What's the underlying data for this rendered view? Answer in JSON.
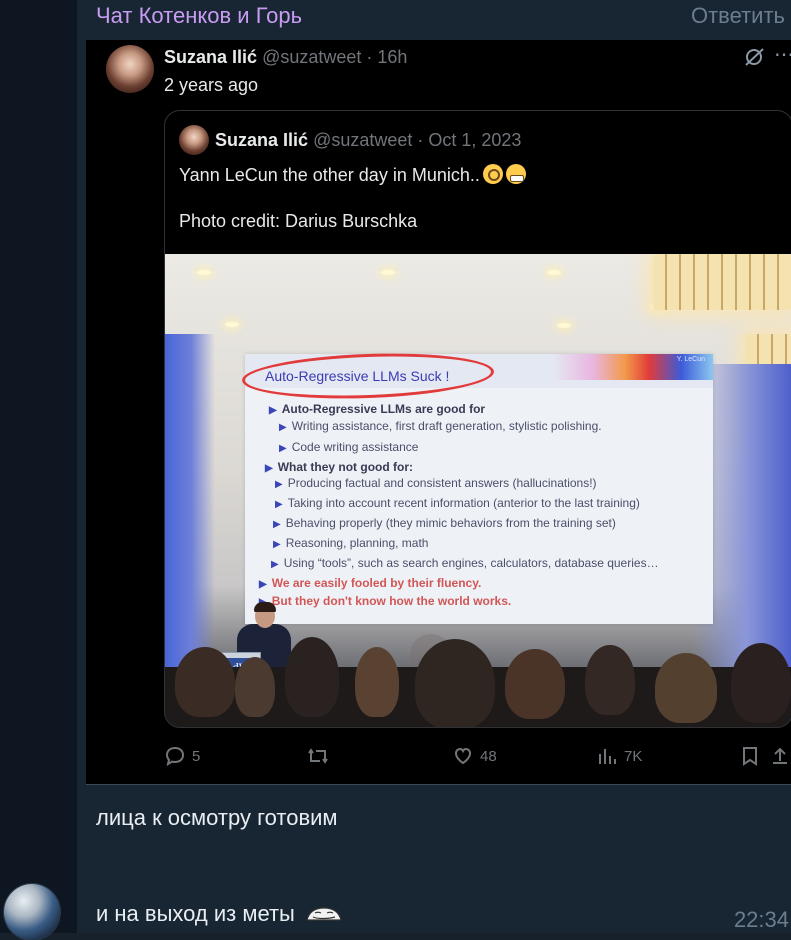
{
  "chat": {
    "title": "Чат Котенков и Горь",
    "reply_label": "Ответить"
  },
  "post": {
    "author_name": "Suzana Ilić",
    "author_meta": "@suzatweet · 16h",
    "body": "2 years ago",
    "icons": {
      "repost_badge": "repost-off-icon",
      "more": "more-icon"
    },
    "quote": {
      "author_name": "Suzana Ilić",
      "author_meta": "@suzatweet · Oct 1, 2023",
      "text_line1": "Yann LeCun the other day in Munich..",
      "text_line2": "Photo credit: Darius Burschka",
      "photo": {
        "slide_title": "Auto-Regressive LLMs Suck !",
        "slide_author": "Y. LeCun",
        "bullets": [
          "Auto-Regressive LLMs are good for",
          "Writing assistance, first draft generation, stylistic polishing.",
          "Code writing assistance",
          "What they not good for:",
          "Producing factual and consistent answers (hallucinations!)",
          "Taking into account recent information (anterior to the last training)",
          "Behaving properly (they mimic behaviors from the training set)",
          "Reasoning, planning, math",
          "Using “tools”, such as search engines, calculators, database queries…",
          "We are easily fooled by their fluency.",
          "But they don't know how the world works."
        ],
        "podium_label": "BAdW"
      }
    },
    "actions": {
      "replies": "5",
      "retweets": "",
      "likes": "48",
      "views": "7K"
    }
  },
  "messages": [
    {
      "text": "лица к осмотру готовим"
    },
    {
      "text": "и на выход из меты",
      "time": "22:34"
    }
  ],
  "colors": {
    "accent": "#c89cf2",
    "bg": "#17212b",
    "embed_bg": "#000000"
  }
}
